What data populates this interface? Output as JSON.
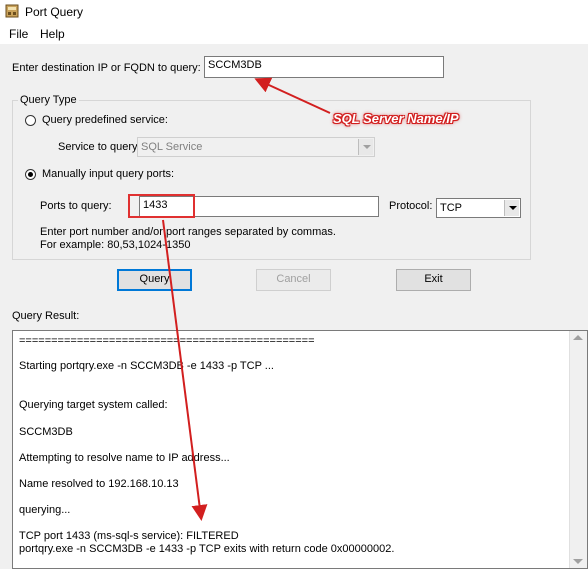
{
  "window": {
    "title": "Port Query"
  },
  "menu": {
    "items": [
      "File",
      "Help"
    ]
  },
  "form": {
    "dest_label": "Enter destination IP or FQDN to query:",
    "dest_value": "SCCM3DB",
    "query_type_title": "Query Type",
    "predefined_label": "Query predefined service:",
    "service_label": "Service to query:",
    "service_value": "SQL Service",
    "manual_label": "Manually input query ports:",
    "ports_label": "Ports to query:",
    "ports_value": "1433",
    "protocol_label": "Protocol:",
    "protocol_value": "TCP",
    "hint_line1": "Enter port number and/or port ranges separated by commas.",
    "hint_line2": "For example: 80,53,1024-1350",
    "selected_query_type": "manual"
  },
  "buttons": {
    "query": "Query",
    "cancel": "Cancel",
    "exit": "Exit"
  },
  "result": {
    "label": "Query Result:",
    "lines": [
      "==============================================",
      " Starting portqry.exe -n SCCM3DB -e 1433 -p TCP ...",
      "Querying target system called:",
      " SCCM3DB",
      "Attempting to resolve name to IP address...",
      "Name resolved to 192.168.10.13",
      "querying...",
      "TCP port 1433 (ms-sql-s service): FILTERED",
      "portqry.exe -n SCCM3DB -e 1433 -p TCP exits with return code 0x00000002."
    ]
  },
  "annotations": {
    "label": "SQL Server Name/IP",
    "color": "#d21f1f"
  }
}
